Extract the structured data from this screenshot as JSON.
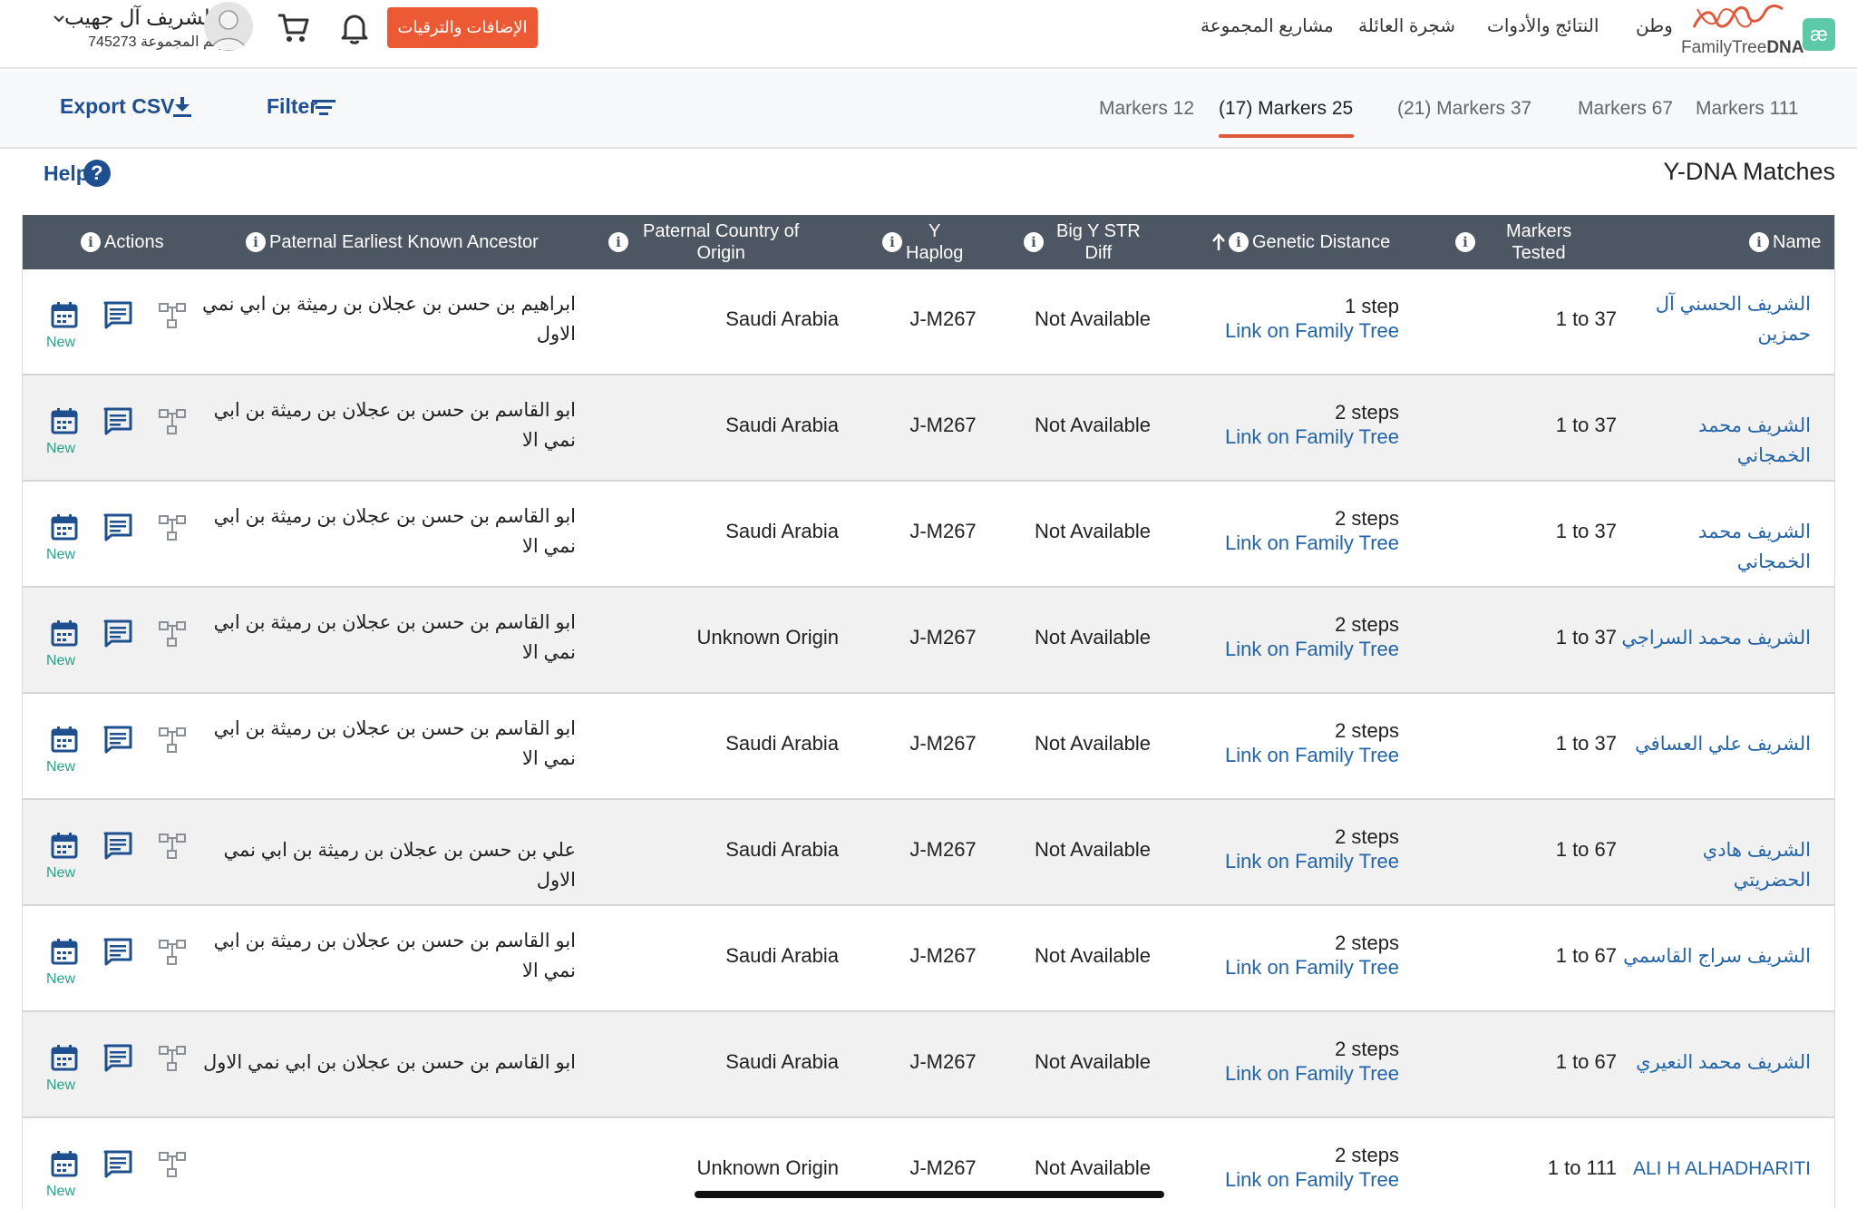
{
  "header": {
    "user_name": "الشريف آل جهيب",
    "group_label": "رقم المجموعة",
    "group_number": "745273",
    "upgrade_button": "الإضافات والترقيات",
    "nav": [
      "مشاريع المجموعة",
      "شجرة العائلة",
      "النتائج والأدوات",
      "وطن"
    ],
    "logo_text_light": "FamilyTree",
    "logo_text_bold": "DNA",
    "logo_badge": "æ"
  },
  "toolbar": {
    "export_label": "Export CSV",
    "filter_label": "Filter",
    "tabs": [
      {
        "label": "Markers 12",
        "active": false
      },
      {
        "label": "(17) Markers 25",
        "active": true
      },
      {
        "label": "(21) Markers 37",
        "active": false
      },
      {
        "label": "Markers 67",
        "active": false
      },
      {
        "label": "Markers 111",
        "active": false
      }
    ]
  },
  "page": {
    "help_label": "Help",
    "title": "Y-DNA Matches"
  },
  "table": {
    "columns": {
      "actions": "Actions",
      "ancestor": "Paternal Earliest Known Ancestor",
      "country_line1": "Paternal Country of",
      "country_line2": "Origin",
      "haplo_line1": "Y",
      "haplo_line2": "Haplog",
      "bigy_line1": "Big Y STR",
      "bigy_line2": "Diff",
      "genetic_distance": "Genetic Distance",
      "markers_line1": "Markers",
      "markers_line2": "Tested",
      "name": "Name"
    },
    "new_badge": "New",
    "rows": [
      {
        "name": "الشريف الحسني آل حمزين",
        "markers": "1 to 37",
        "steps": "1 step",
        "link": "Link on Family Tree",
        "bigy": "Not Available",
        "haplo": "J-M267",
        "country": "Saudi Arabia",
        "ancestor": "ابراهيم بن حسن بن عجلان بن رميثة بن ابي نمي الاول"
      },
      {
        "name": "الشريف محمد الخمجاني",
        "markers": "1 to 37",
        "steps": "2 steps",
        "link": "Link on Family Tree",
        "bigy": "Not Available",
        "haplo": "J-M267",
        "country": "Saudi Arabia",
        "ancestor": "ابو القاسم بن حسن بن عجلان بن رميثة بن ابي نمي الا"
      },
      {
        "name": "الشريف محمد الخمجاني",
        "markers": "1 to 37",
        "steps": "2 steps",
        "link": "Link on Family Tree",
        "bigy": "Not Available",
        "haplo": "J-M267",
        "country": "Saudi Arabia",
        "ancestor": "ابو القاسم بن حسن بن عجلان بن رميثة بن ابي نمي الا"
      },
      {
        "name": "الشريف محمد السراجي",
        "markers": "1 to 37",
        "steps": "2 steps",
        "link": "Link on Family Tree",
        "bigy": "Not Available",
        "haplo": "J-M267",
        "country": "Unknown Origin",
        "ancestor": "ابو القاسم بن حسن بن عجلان بن رميثة بن ابي نمي الا"
      },
      {
        "name": "الشريف علي العسافي",
        "markers": "1 to 37",
        "steps": "2 steps",
        "link": "Link on Family Tree",
        "bigy": "Not Available",
        "haplo": "J-M267",
        "country": "Saudi Arabia",
        "ancestor": "ابو القاسم بن حسن بن عجلان بن رميثة بن ابي نمي الا"
      },
      {
        "name": "الشريف هادي الحضريتي",
        "markers": "1 to 67",
        "steps": "2 steps",
        "link": "Link on Family Tree",
        "bigy": "Not Available",
        "haplo": "J-M267",
        "country": "Saudi Arabia",
        "ancestor": "علي بن حسن بن عجلان بن رميثة بن ابي نمي الاول"
      },
      {
        "name": "الشريف سراج القاسمي",
        "markers": "1 to 67",
        "steps": "2 steps",
        "link": "Link on Family Tree",
        "bigy": "Not Available",
        "haplo": "J-M267",
        "country": "Saudi Arabia",
        "ancestor": "ابو القاسم بن حسن بن عجلان بن رميثة بن ابي نمي الا"
      },
      {
        "name": "الشريف محمد النعيري",
        "markers": "1 to 67",
        "steps": "2 steps",
        "link": "Link on Family Tree",
        "bigy": "Not Available",
        "haplo": "J-M267",
        "country": "Saudi Arabia",
        "ancestor": "ابو القاسم بن حسن بن عجلان بن ابي نمي الاول"
      },
      {
        "name": "ALI H ALHADHARITI",
        "markers": "1 to 111",
        "steps": "2 steps",
        "link": "Link on Family Tree",
        "bigy": "Not Available",
        "haplo": "J-M267",
        "country": "Unknown Origin",
        "ancestor": ""
      }
    ]
  },
  "colors": {
    "accent": "#ec5a35",
    "link": "#2464a8",
    "header_bg": "#4d5763",
    "new_badge": "#2aa189"
  }
}
